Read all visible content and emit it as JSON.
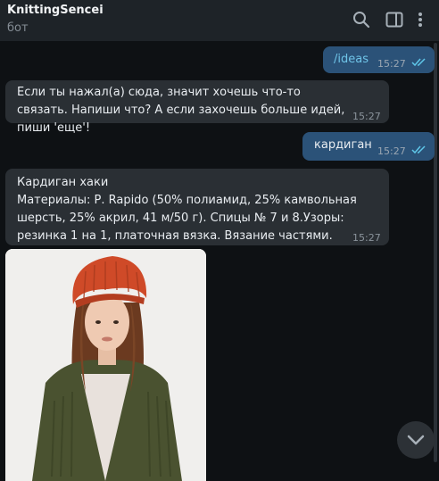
{
  "header": {
    "title": "KnittingSencei",
    "subtitle": "бот"
  },
  "messages": [
    {
      "dir": "out",
      "text": "/ideas",
      "time": "15:27",
      "read": true
    },
    {
      "dir": "in",
      "text": "Если ты нажал(а) сюда, значит хочешь что-то связать. Напиши что? А если захочешь больше идей, пиши 'еще'!",
      "time": "15:27"
    },
    {
      "dir": "out",
      "text": "кардиган",
      "time": "15:27",
      "read": true
    },
    {
      "dir": "in",
      "text": "Кардиган хаки\nМатериалы: Р. Rapido (50% полиамид, 25% камвольная шерсть, 25% акрил, 41 м/50 г). Спицы № 7 и 8.Узоры: резинка 1 на 1, платочная вязка. Вязание частями.",
      "time": "15:27"
    }
  ],
  "colors": {
    "outgoing_bubble": "#2b5278",
    "incoming_bubble": "#2a2f34",
    "link": "#6fc4e8",
    "read_ticks": "#5ec6e8"
  },
  "icons": [
    "search-icon",
    "sidebar-toggle-icon",
    "more-vertical-icon",
    "chevron-down-icon",
    "double-check-icon"
  ]
}
